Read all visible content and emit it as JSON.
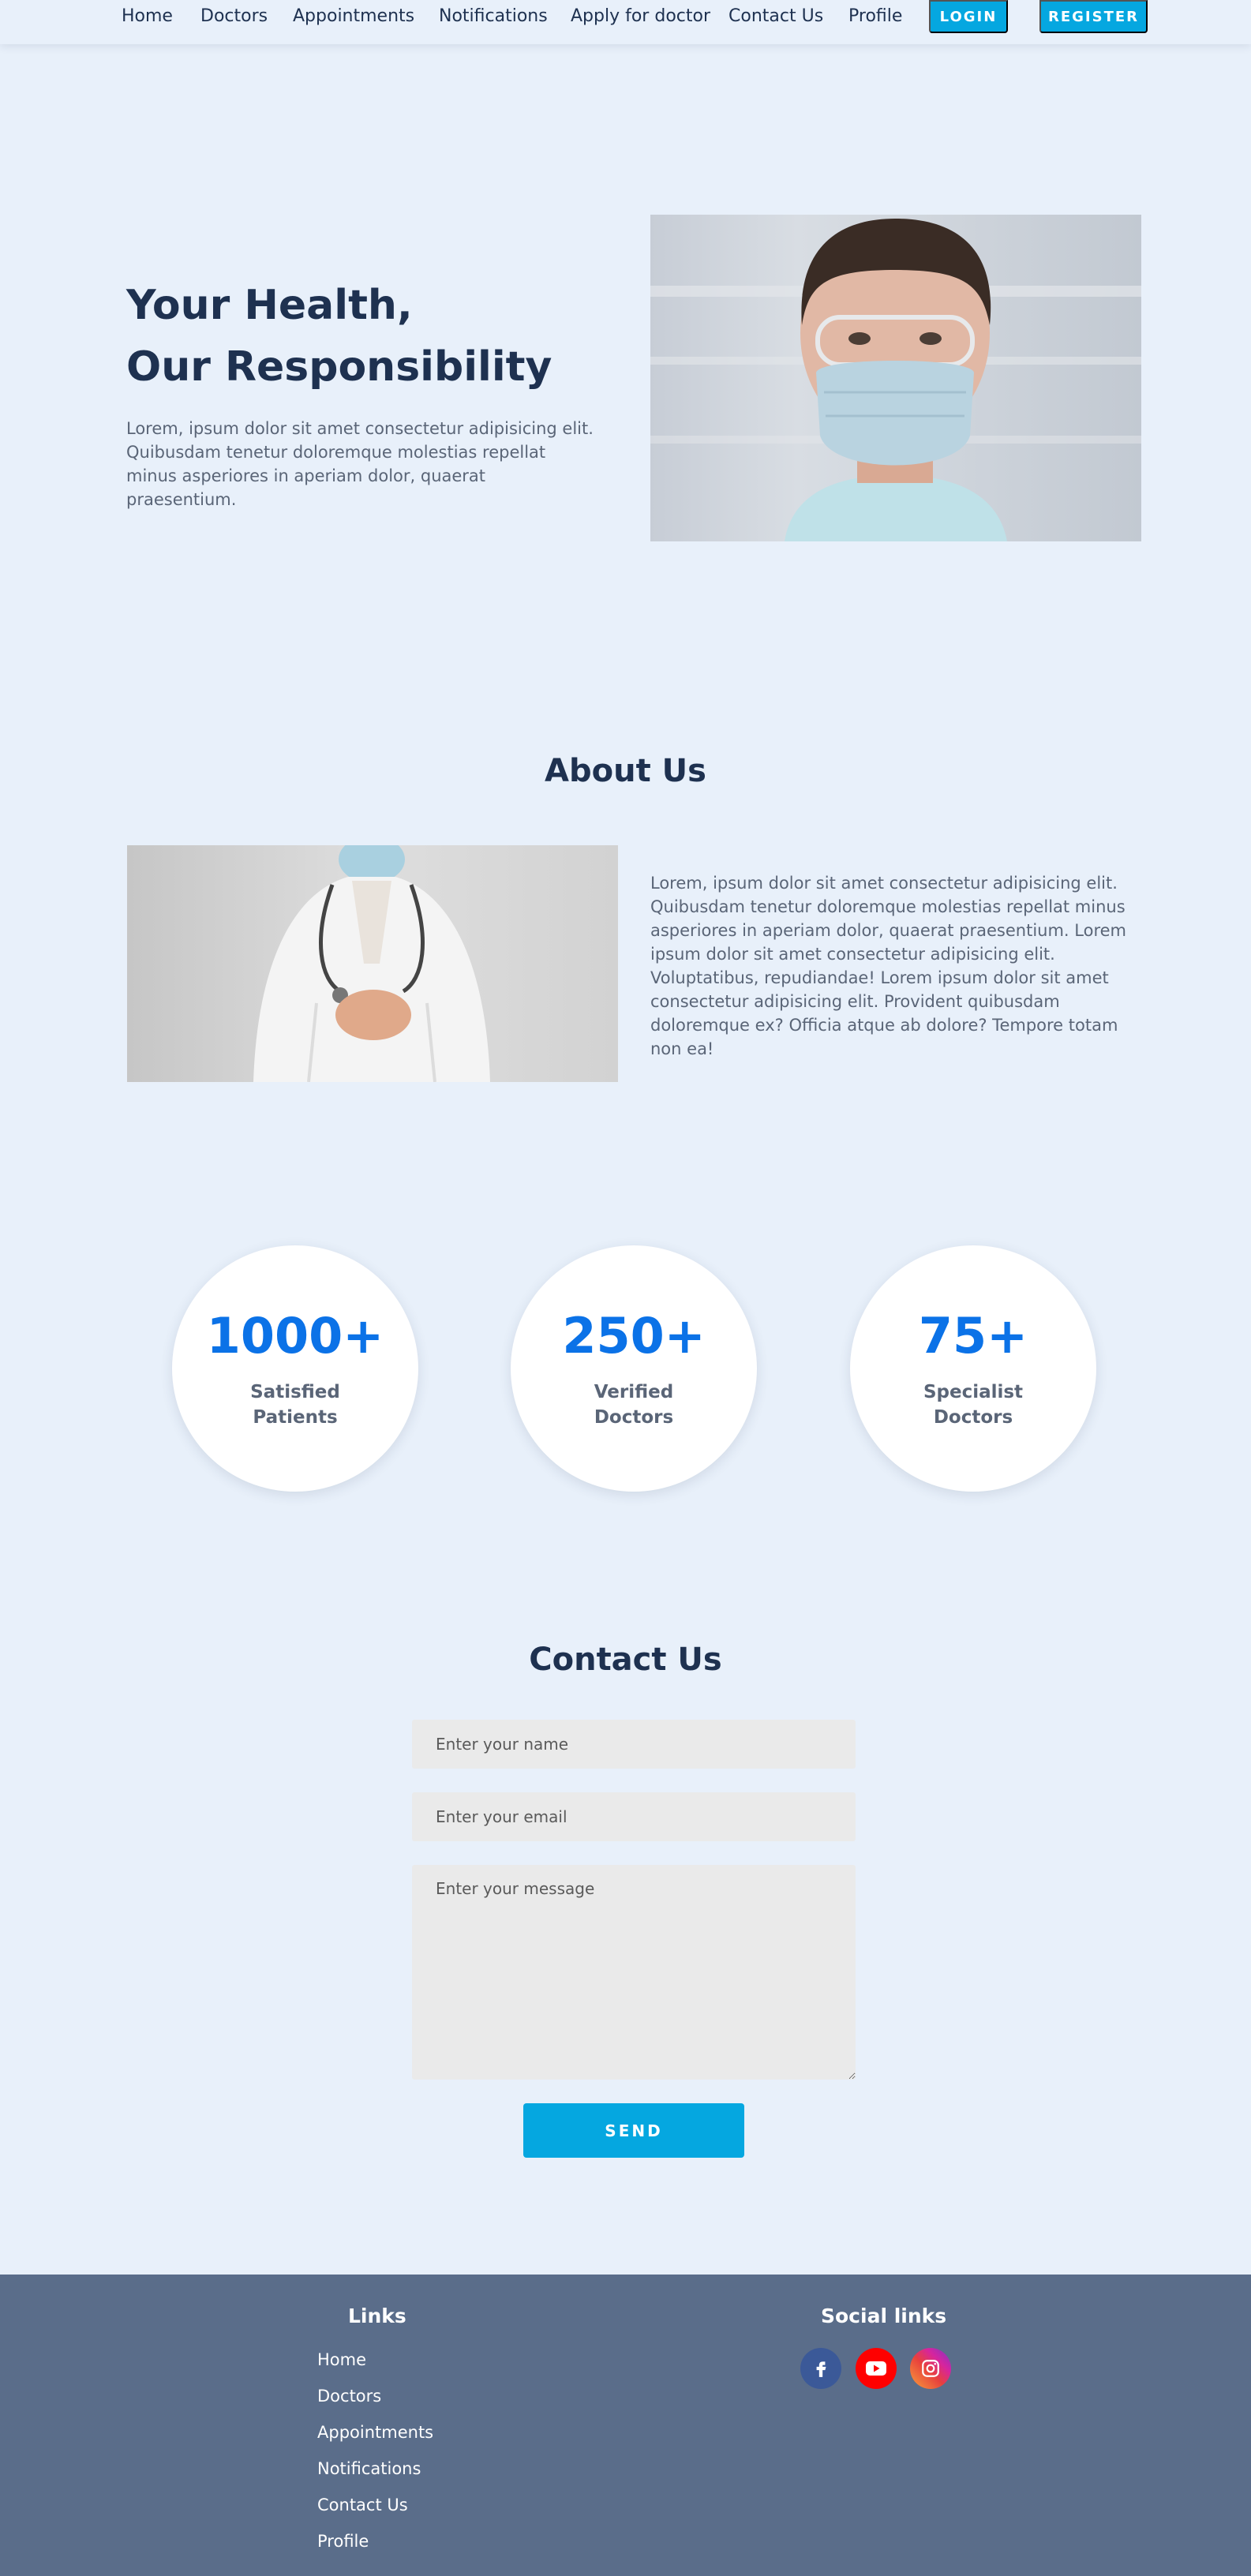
{
  "nav": {
    "items": [
      "Home",
      "Doctors",
      "Appointments",
      "Notifications",
      "Apply for doctor",
      "Contact Us",
      "Profile"
    ],
    "login_label": "LOGIN",
    "register_label": "REGISTER",
    "accent_color": "#05a7e0"
  },
  "hero": {
    "title_line1": "Your Health,",
    "title_line2": "Our Responsibility",
    "text": "Lorem, ipsum dolor sit amet consectetur adipisicing elit. Quibusdam tenetur doloremque molestias repellat minus asperiores in aperiam dolor, quaerat praesentium."
  },
  "about": {
    "title": "About Us",
    "text": "Lorem, ipsum dolor sit amet consectetur adipisicing elit. Quibusdam tenetur doloremque molestias repellat minus asperiores in aperiam dolor, quaerat praesentium. Lorem ipsum dolor sit amet consectetur adipisicing elit. Voluptatibus, repudiandae! Lorem ipsum dolor sit amet consectetur adipisicing elit. Provident quibusdam doloremque ex? Officia atque ab dolore? Tempore totam non ea!"
  },
  "stats": [
    {
      "value": "1000+",
      "line1": "Satisfied",
      "line2": "Patients"
    },
    {
      "value": "250+",
      "line1": "Verified",
      "line2": "Doctors"
    },
    {
      "value": "75+",
      "line1": "Specialist",
      "line2": "Doctors"
    }
  ],
  "contact": {
    "title": "Contact Us",
    "name_placeholder": "Enter your name",
    "email_placeholder": "Enter your email",
    "message_placeholder": "Enter your message",
    "send_label": "SEND"
  },
  "footer": {
    "links_heading": "Links",
    "links": [
      "Home",
      "Doctors",
      "Appointments",
      "Notifications",
      "Contact Us",
      "Profile"
    ],
    "social_heading": "Social links",
    "social": [
      {
        "icon": "facebook-icon",
        "color": "#3b5998"
      },
      {
        "icon": "youtube-icon",
        "color": "#ff0000"
      },
      {
        "icon": "instagram-icon",
        "color": "#d6249f"
      }
    ]
  }
}
